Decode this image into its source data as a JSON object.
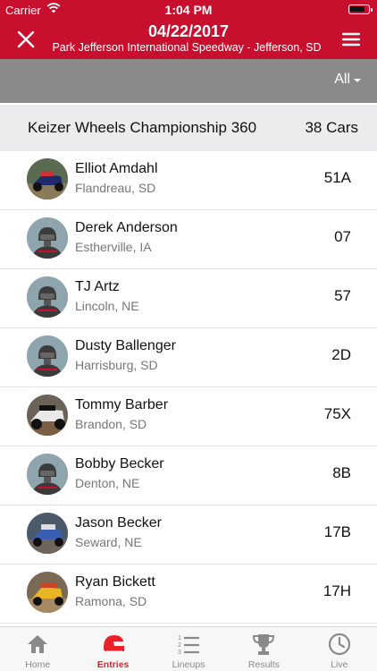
{
  "status_bar": {
    "carrier": "Carrier",
    "time": "1:04 PM",
    "battery_level": 0.85
  },
  "header": {
    "title": "04/22/2017",
    "subtitle": "Park Jefferson International Speedway - Jefferson, SD"
  },
  "filter": {
    "label": "All"
  },
  "race_class": {
    "name": "Keizer Wheels Championship 360",
    "count": "38 Cars"
  },
  "entries": [
    {
      "name": "Elliot Amdahl",
      "location": "Flandreau, SD",
      "car": "51A",
      "avatar": "photo"
    },
    {
      "name": "Derek Anderson",
      "location": "Estherville, IA",
      "car": "07",
      "avatar": "default"
    },
    {
      "name": "TJ Artz",
      "location": "Lincoln, NE",
      "car": "57",
      "avatar": "default"
    },
    {
      "name": "Dusty Ballenger",
      "location": "Harrisburg, SD",
      "car": "2D",
      "avatar": "default"
    },
    {
      "name": "Tommy Barber",
      "location": "Brandon, SD",
      "car": "75X",
      "avatar": "photo"
    },
    {
      "name": "Bobby Becker",
      "location": "Denton, NE",
      "car": "8B",
      "avatar": "default"
    },
    {
      "name": "Jason Becker",
      "location": "Seward, NE",
      "car": "17B",
      "avatar": "photo"
    },
    {
      "name": "Ryan Bickett",
      "location": "Ramona, SD",
      "car": "17H",
      "avatar": "photo"
    }
  ],
  "tabs": [
    {
      "label": "Home",
      "icon": "home-icon",
      "active": false
    },
    {
      "label": "Entries",
      "icon": "helmet-icon",
      "active": true
    },
    {
      "label": "Lineups",
      "icon": "list-icon",
      "active": false
    },
    {
      "label": "Results",
      "icon": "trophy-icon",
      "active": false
    },
    {
      "label": "Live",
      "icon": "clock-icon",
      "active": false
    }
  ],
  "colors": {
    "brand_red": "#c8102e",
    "active_tab": "#e8212a",
    "filter_bar": "#8a8a8a"
  }
}
